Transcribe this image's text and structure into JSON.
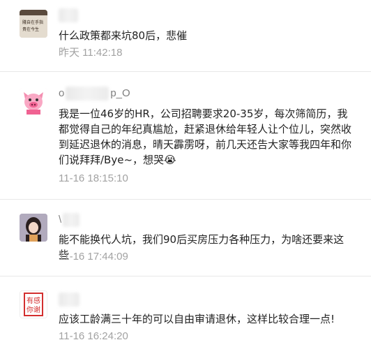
{
  "comments": [
    {
      "nick_visible": "",
      "text": "什么政策都来坑80后，悲催",
      "time": "昨天 11:42:18",
      "avatar_icon": "photo-avatar-handwriting-icon"
    },
    {
      "nick_prefix": "o",
      "nick_suffix": "p_O",
      "text": "我是一位46岁的HR，公司招聘要求20-35岁，每次筛简历，我都觉得自己的年纪真尴尬，赶紧退休给年轻人让个位儿，突然收到延迟退休的消息，晴天霹雳呀，前几天还告大家等我四年和你们说拜拜/Bye~，想哭😭",
      "time": "11-16 18:15:10",
      "avatar_icon": "pink-pig-avatar-icon"
    },
    {
      "nick_prefix": "\\",
      "text": "能不能换代人坑，我们90后买房压力各种压力，为啥还要来这些",
      "time": "11-16 17:44:09",
      "avatar_icon": "girl-portrait-avatar-icon"
    },
    {
      "nick_prefix": "",
      "text": "应该工龄满三十年的可以自由审请退休，这样比较合理一点!",
      "time": "11-16 16:24:20",
      "avatar_icon": "red-seal-avatar-icon"
    }
  ],
  "colors": {
    "text": "#222222",
    "meta": "#a2a2a2",
    "divider": "#e8e8e8"
  }
}
